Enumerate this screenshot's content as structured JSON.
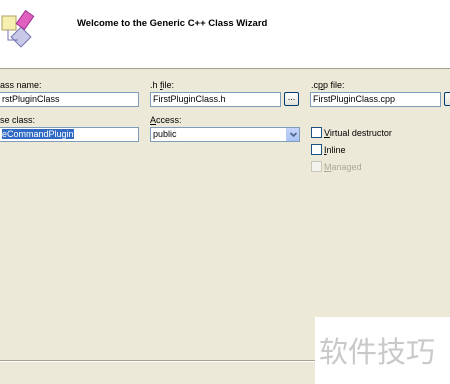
{
  "header": {
    "title": "Welcome to the Generic C++ Class Wizard"
  },
  "fields": {
    "class_name": {
      "label_visible": "ass name:",
      "value": "rstPluginClass"
    },
    "h_file": {
      "label_prefix": ".h ",
      "label_mnemonic": "f",
      "label_suffix": "ile:",
      "value": "FirstPluginClass.h",
      "browse_label": "..."
    },
    "cpp_file": {
      "label_prefix": ".c",
      "label_mnemonic": "p",
      "label_suffix": "p file:",
      "value": "FirstPluginClass.cpp",
      "browse_label": ""
    },
    "base_class": {
      "label_visible": "se class:",
      "value": "eCommandPlugin"
    },
    "access": {
      "label_mnemonic": "A",
      "label_suffix": "ccess:",
      "value": "public"
    }
  },
  "options": {
    "virtual_destructor": {
      "mnemonic": "V",
      "rest": "irtual destructor",
      "checked": false
    },
    "inline": {
      "mnemonic": "I",
      "rest": "nline",
      "checked": false
    },
    "managed": {
      "mnemonic": "M",
      "rest": "anaged",
      "checked": false,
      "disabled": true
    }
  },
  "watermark": {
    "text": "软件技巧"
  },
  "colors": {
    "selection": "#316ac5",
    "dialog_bg": "#ece9d8",
    "border": "#7f9db9"
  }
}
